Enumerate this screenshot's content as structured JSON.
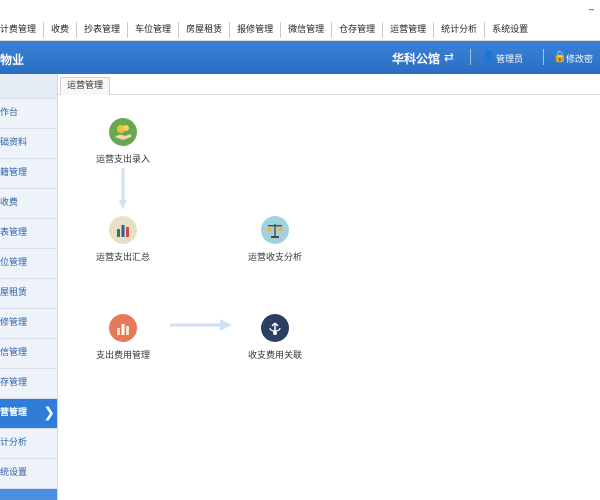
{
  "menu": {
    "items": [
      "计费管理",
      "收费",
      "抄表管理",
      "车位管理",
      "房屋租赁",
      "报修管理",
      "微信管理",
      "仓存管理",
      "运营管理",
      "统计分析",
      "系统设置"
    ],
    "minimize": "_"
  },
  "header": {
    "brand": "物业",
    "org": "华科公馆",
    "user": "管理员",
    "password": "修改密"
  },
  "sidebar": {
    "items": [
      "作台",
      "础资料",
      "籍管理",
      "收费",
      "表管理",
      "位管理",
      "屋租赁",
      "修管理",
      "信管理",
      "存管理",
      "营管理",
      "计分析",
      "统设置"
    ],
    "active_index": 10
  },
  "tabs": [
    {
      "label": "运营管理"
    }
  ],
  "flow": {
    "nodes": [
      {
        "label": "运营支出录入",
        "icon": "money-hand-icon",
        "color": "#6aa84f"
      },
      {
        "label": "运营支出汇总",
        "icon": "bar-chart-icon",
        "color": "#e8e0c6"
      },
      {
        "label": "运营收支分析",
        "icon": "balance-scale-icon",
        "color": "#9fd1de"
      },
      {
        "label": "支出费用管理",
        "icon": "bar-chart-icon",
        "color": "#e8785a"
      },
      {
        "label": "收支费用关联",
        "icon": "share-link-icon",
        "color": "#2c3e63"
      }
    ]
  },
  "colors": {
    "accent": "#2f7cd9",
    "arrow": "#cfe2f5"
  }
}
